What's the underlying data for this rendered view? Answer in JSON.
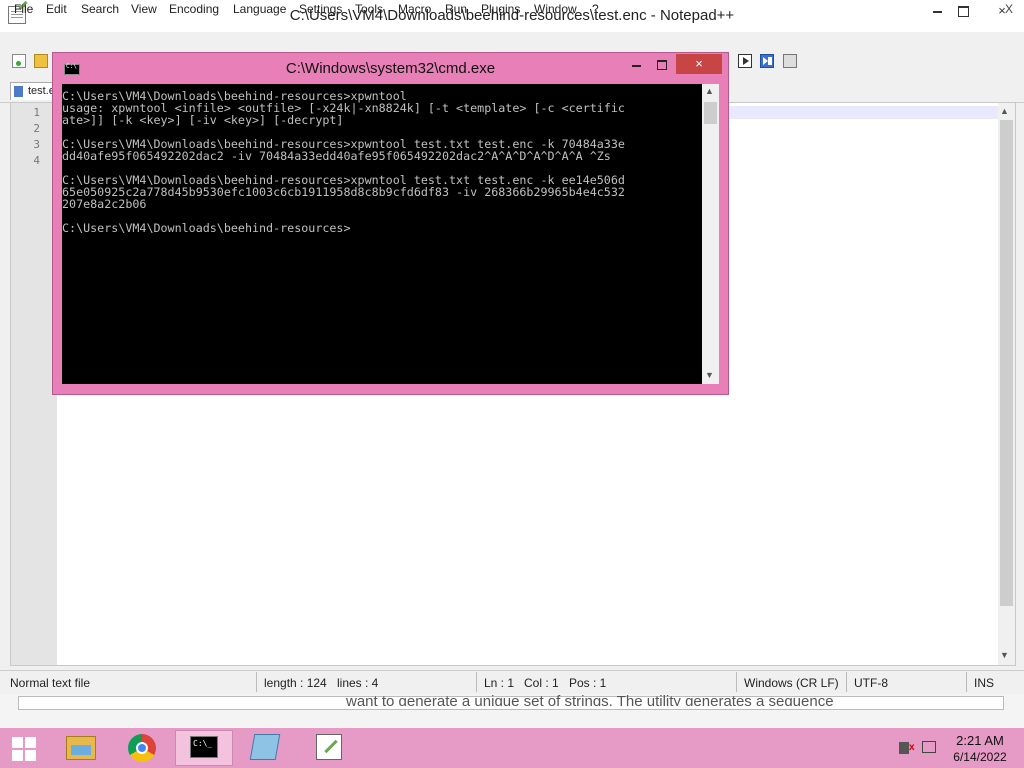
{
  "notepad": {
    "title": "C:\\Users\\VM4\\Downloads\\beehind-resources\\test.enc - Notepad++",
    "close_glyph": "×",
    "menu": [
      "File",
      "Edit",
      "Search",
      "View",
      "Encoding",
      "Language",
      "Settings",
      "Tools",
      "Macro",
      "Run",
      "Plugins",
      "Window",
      "?"
    ],
    "menu_close": "X",
    "tab_label": "test.e",
    "line_numbers": [
      "1",
      "2",
      "3",
      "4"
    ],
    "status": {
      "file_type": "Normal text file",
      "length": "length : 124",
      "lines": "lines : 4",
      "ln": "Ln : 1",
      "col": "Col : 1",
      "pos": "Pos : 1",
      "eol": "Windows (CR LF)",
      "encoding": "UTF-8",
      "mode": "INS"
    }
  },
  "cmd": {
    "title": "C:\\Windows\\system32\\cmd.exe",
    "close_glyph": "×",
    "output": "C:\\Users\\VM4\\Downloads\\beehind-resources>xpwntool\nusage: xpwntool <infile> <outfile> [-x24k|-xn8824k] [-t <template> [-c <certific\nate>]] [-k <key>] [-iv <key>] [-decrypt]\n\nC:\\Users\\VM4\\Downloads\\beehind-resources>xpwntool test.txt test.enc -k 70484a33e\ndd40afe95f065492202dac2 -iv 70484a33edd40afe95f065492202dac2^A^A^D^A^D^A^A ^Zs\n\nC:\\Users\\VM4\\Downloads\\beehind-resources>xpwntool test.txt test.enc -k ee14e506d\n65e050925c2a778d45b9530efc1003c6cb1911958d8c8b9cfd6df83 -iv 268366b29965b4e4c532\n207e8a2c2b06\n\nC:\\Users\\VM4\\Downloads\\beehind-resources>"
  },
  "background_window_text": "want to generate a unique set of strings. The utility generates a sequence",
  "taskbar": {
    "time": "2:21 AM",
    "date": "6/14/2022"
  },
  "icons": [
    "notepadpp-icon",
    "new-file-icon",
    "open-file-icon",
    "play-macro-icon",
    "run-macro-multiple-icon",
    "save-macro-icon",
    "cmd-icon",
    "windows-start-icon",
    "file-explorer-icon",
    "chrome-icon",
    "notepad-icon",
    "sound-muted-icon",
    "network-icon"
  ],
  "colors": {
    "cmd_frame": "#e87fb6",
    "taskbar": "#e69ac6",
    "cmd_close": "#c74545",
    "console_bg": "#000000",
    "console_text": "#c0c0c0"
  }
}
